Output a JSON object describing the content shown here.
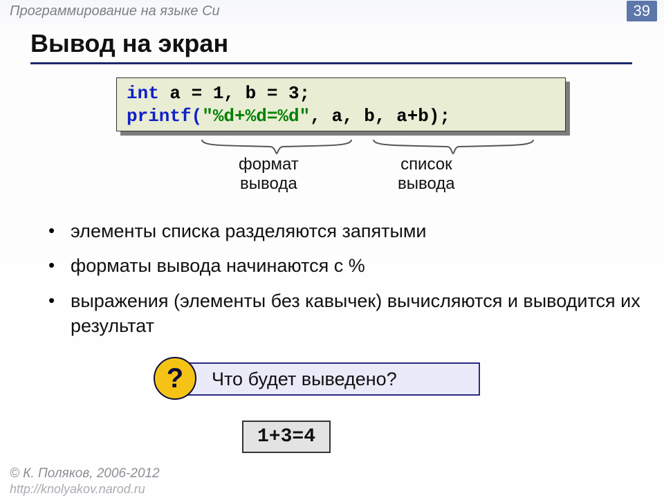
{
  "header": {
    "subject": "Программирование на языке Си",
    "page_number": "39"
  },
  "title": "Вывод на экран",
  "code": {
    "line1_kw": "int",
    "line1_rest": " a = 1, b = 3;",
    "line2_kw": "printf(",
    "line2_fmt": "\"%d+%d=%d\"",
    "line2_args": ", a, b, a+b);"
  },
  "brace_labels": {
    "format": "формат\nвывода",
    "list": "список\nвывода"
  },
  "bullets": [
    "элементы списка разделяются запятыми",
    "форматы вывода начинаются с %",
    "выражения (элементы без кавычек) вычисляются и выводится их результат"
  ],
  "question": {
    "mark": "?",
    "text": "Что будет выведено?"
  },
  "answer": "1+3=4",
  "footer": {
    "author": "© К. Поляков, 2006-2012",
    "url": "http://knolyakov.narod.ru"
  }
}
